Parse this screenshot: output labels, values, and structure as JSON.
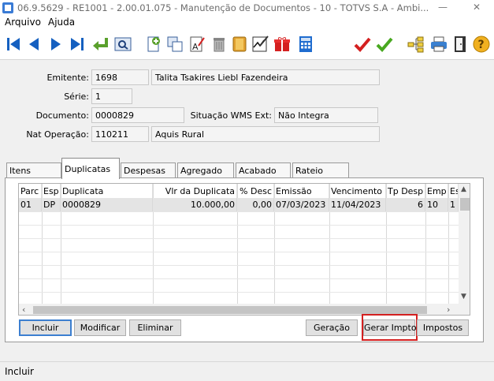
{
  "window": {
    "title": "06.9.5629 - RE1001 - 2.00.01.075 - Manutenção de Documentos - 10 - TOTVS S.A - Ambi..."
  },
  "menu": {
    "items": [
      "Arquivo",
      "Ajuda"
    ]
  },
  "toolbar": {
    "icons": [
      "first-record-icon",
      "previous-record-icon",
      "next-record-icon",
      "last-record-icon",
      "go-to-icon",
      "search-icon",
      "new-icon",
      "copy-icon",
      "edit-icon",
      "delete-icon",
      "cancel-icon",
      "sign-icon",
      "gift-icon",
      "calculator-icon",
      "confirm-icon",
      "ok-icon",
      "tree-icon",
      "print-icon",
      "exit-icon",
      "help-icon"
    ]
  },
  "form": {
    "emitente_label": "Emitente:",
    "emitente_code": "1698",
    "emitente_name": "Talita Tsakires Liebl Fazendeira",
    "serie_label": "Série:",
    "serie_value": "1",
    "documento_label": "Documento:",
    "documento_value": "0000829",
    "situacao_label": "Situação WMS Ext:",
    "situacao_value": "Não Integra",
    "natop_label": "Nat Operação:",
    "natop_code": "110211",
    "natop_name": "Aquis Rural"
  },
  "tabs": [
    "Itens",
    "Duplicatas",
    "Despesas",
    "Agregado",
    "Acabado",
    "Rateio"
  ],
  "grid": {
    "columns": [
      "Parc",
      "Esp",
      "Duplicata",
      "Vlr da Duplicata",
      "% Desc",
      "Emissão",
      "Vencimento",
      "Tp Desp",
      "Emp",
      "Es"
    ],
    "rows": [
      [
        "01",
        "DP",
        "0000829",
        "10.000,00",
        "0,00",
        "07/03/2023",
        "11/04/2023",
        "6",
        "10",
        "1"
      ]
    ]
  },
  "buttons": {
    "incluir": "Incluir",
    "modificar": "Modificar",
    "eliminar": "Eliminar",
    "geracao": "Geração",
    "gerar_impto": "Gerar Impto",
    "impostos": "Impostos"
  },
  "status": {
    "text": "Incluir"
  },
  "colors": {
    "highlight": "#d42020",
    "selected_row": "#e4e4e4",
    "toolbar_blue": "#1560c0"
  }
}
